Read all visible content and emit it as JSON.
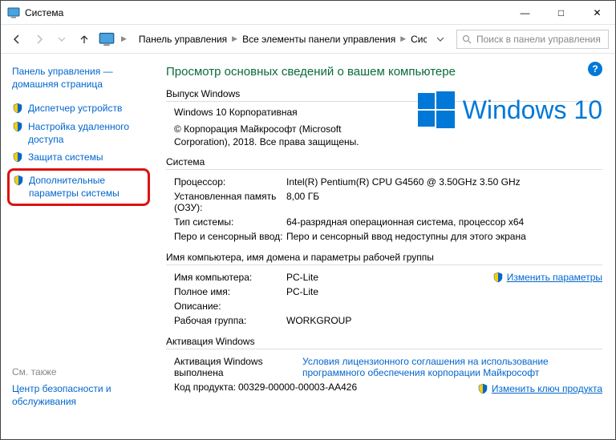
{
  "window": {
    "title": "Система"
  },
  "breadcrumbs": {
    "items": [
      "Панель управления",
      "Все элементы панели управления",
      "Система"
    ]
  },
  "search": {
    "placeholder": "Поиск в панели управления"
  },
  "sidebar": {
    "home": "Панель управления — домашняя страница",
    "items": [
      {
        "label": "Диспетчер устройств"
      },
      {
        "label": "Настройка удаленного доступа"
      },
      {
        "label": "Защита системы"
      },
      {
        "label": "Дополнительные параметры системы",
        "highlighted": true
      }
    ],
    "see_also_header": "См. также",
    "see_also": "Центр безопасности и обслуживания"
  },
  "page": {
    "title": "Просмотр основных сведений о вашем компьютере"
  },
  "edition": {
    "header": "Выпуск Windows",
    "name": "Windows 10 Корпоративная",
    "copyright": "© Корпорация Майкрософт (Microsoft Corporation), 2018. Все права защищены.",
    "logo_text": "Windows 10"
  },
  "system": {
    "header": "Система",
    "rows": [
      {
        "k": "Процессор:",
        "v": "Intel(R) Pentium(R) CPU G4560 @ 3.50GHz   3.50 GHz"
      },
      {
        "k": "Установленная память (ОЗУ):",
        "v": "8,00 ГБ"
      },
      {
        "k": "Тип системы:",
        "v": "64-разрядная операционная система, процессор x64"
      },
      {
        "k": "Перо и сенсорный ввод:",
        "v": "Перо и сенсорный ввод недоступны для этого экрана"
      }
    ]
  },
  "naming": {
    "header": "Имя компьютера, имя домена и параметры рабочей группы",
    "change_link": "Изменить параметры",
    "rows": [
      {
        "k": "Имя компьютера:",
        "v": "PC-Lite"
      },
      {
        "k": "Полное имя:",
        "v": "PC-Lite"
      },
      {
        "k": "Описание:",
        "v": ""
      },
      {
        "k": "Рабочая группа:",
        "v": "WORKGROUP"
      }
    ]
  },
  "activation": {
    "header": "Активация Windows",
    "status_k": "Активация Windows выполнена",
    "license_link": "Условия лицензионного соглашения на использование программного обеспечения корпорации Майкрософт",
    "product_k": "Код продукта:",
    "product_v": "00329-00000-00003-AA426",
    "change_key_link": "Изменить ключ продукта"
  }
}
